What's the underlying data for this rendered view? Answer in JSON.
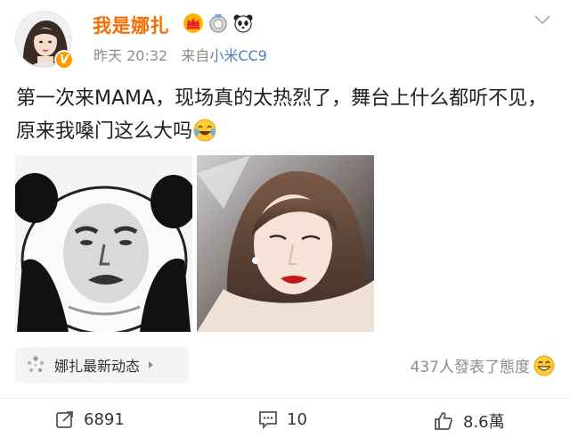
{
  "post": {
    "username": "我是娜扎",
    "time": "昨天 20:32",
    "source_prefix": "来自",
    "source": "小米CC9",
    "text": "第一次来MAMA，现场真的太热烈了，舞台上什么都听不见，原来我嗓门这么大吗",
    "emoji_after_text": "laughing-crying-emoji",
    "badges": [
      "crown-badge",
      "medal-badge",
      "panda-badge"
    ],
    "verified_icon": "verified-v-icon"
  },
  "topic": {
    "label": "娜扎最新动态",
    "icon": "topic-dots-icon"
  },
  "reactions": {
    "text": "437人發表了態度",
    "icon": "grin-emoji"
  },
  "actions": {
    "repost": "6891",
    "comment": "10",
    "like": "8.6萬"
  },
  "colors": {
    "username": "#f86b00",
    "source_link": "#4d7eb5",
    "meta": "#8c8c8c",
    "background": "#ffffff"
  }
}
